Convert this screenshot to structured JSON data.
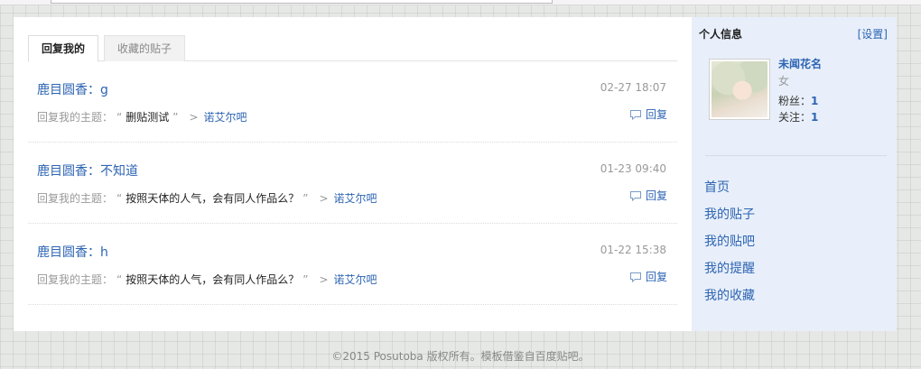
{
  "tabs": [
    {
      "label": "回复我的",
      "active": true
    },
    {
      "label": "收藏的贴子",
      "active": false
    }
  ],
  "replies": [
    {
      "title": "鹿目圆香：g",
      "time": "02-27 18:07",
      "meta_prefix": "回复我的主题：",
      "quote_open": "“",
      "subject": "删贴测试",
      "quote_close": "”",
      "arrow": ">",
      "forum": "诺艾尔吧",
      "reply_label": "回复"
    },
    {
      "title": "鹿目圆香：不知道",
      "time": "01-23 09:40",
      "meta_prefix": "回复我的主题：",
      "quote_open": "“",
      "subject": "按照天体的人气，会有同人作品么？",
      "quote_close": "”",
      "arrow": ">",
      "forum": "诺艾尔吧",
      "reply_label": "回复"
    },
    {
      "title": "鹿目圆香：h",
      "time": "01-22 15:38",
      "meta_prefix": "回复我的主题：",
      "quote_open": "“",
      "subject": "按照天体的人气，会有同人作品么？",
      "quote_close": "”",
      "arrow": ">",
      "forum": "诺艾尔吧",
      "reply_label": "回复"
    }
  ],
  "sidebar": {
    "heading": "个人信息",
    "settings": "[设置]",
    "username": "未闻花名",
    "gender": "女",
    "fans_label": "粉丝：",
    "fans_count": "1",
    "follow_label": "关注：",
    "follow_count": "1",
    "nav": [
      {
        "label": "首页"
      },
      {
        "label": "我的贴子"
      },
      {
        "label": "我的贴吧"
      },
      {
        "label": "我的提醒"
      },
      {
        "label": "我的收藏"
      }
    ]
  },
  "footer": "©2015 Posutoba 版权所有。模板借鉴自百度贴吧。",
  "icons": {
    "reply": "comment-bubble-icon"
  },
  "colors": {
    "link": "#2d64b3",
    "sidebar_bg": "#e8effa"
  }
}
